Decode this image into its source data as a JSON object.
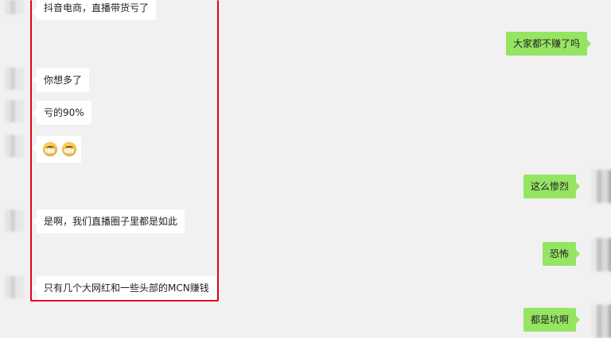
{
  "messages_left": [
    {
      "text": "抖音电商，直播带货亏了"
    },
    {
      "text": "你想多了"
    },
    {
      "text": "亏的90%"
    },
    {
      "emoji": [
        "grin-emoji",
        "grin-emoji"
      ]
    },
    {
      "text": "是啊，我们直播圈子里都是如此"
    },
    {
      "text": "只有几个大网红和一些头部的MCN赚钱"
    }
  ],
  "messages_right": [
    {
      "text": "大家都不赚了吗"
    },
    {
      "text": "这么惨烈"
    },
    {
      "text": "恐怖"
    },
    {
      "text": "都是坑啊"
    }
  ],
  "colors": {
    "background": "#f1f1f1",
    "bubble_left": "#ffffff",
    "bubble_right": "#95e563",
    "highlight_border": "#e3001b"
  }
}
